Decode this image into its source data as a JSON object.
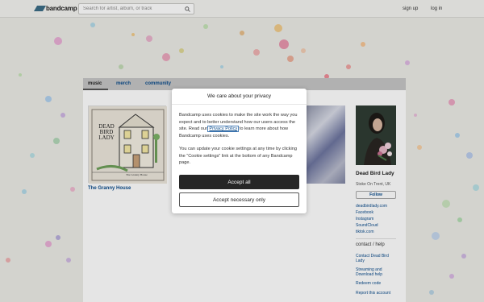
{
  "header": {
    "logo_text": "bandcamp",
    "search_placeholder": "Search for artist, album, or track",
    "sign_up": "sign up",
    "log_in": "log in"
  },
  "tabs": [
    {
      "label": "music"
    },
    {
      "label": "merch"
    },
    {
      "label": "community"
    }
  ],
  "album": {
    "title": "The Granny House",
    "art_text": [
      "DEAD",
      "BIRD",
      "LADY",
      "The Granny House"
    ]
  },
  "artist": {
    "name": "Dead Bird Lady",
    "location": "Stoke On Trent, UK",
    "follow_label": "Follow",
    "links": [
      "deadbirdlady.com",
      "Facebook",
      "Instagram",
      "SoundCloud",
      "tiktok.com"
    ],
    "contact_heading": "contact / help",
    "contact_links": [
      "Contact Dead Bird Lady",
      "Streaming and Download help",
      "Redeem code",
      "Report this account"
    ]
  },
  "cookie_dialog": {
    "title": "We care about your privacy",
    "para1_before": "Bandcamp uses cookies to make the site work the way you expect and to better understand how our users access the site. Read our ",
    "privacy_link": "Privacy Policy",
    "para1_after": " to learn more about how Bandcamp uses cookies.",
    "para2": "You can update your cookie settings at any time by clicking the “Cookie settings” link at the bottom of any Bandcamp page.",
    "accept_all": "Accept all",
    "accept_necessary": "Accept necessary only"
  },
  "colors": {
    "link": "#0b4c8c",
    "brand": "#3b6d86",
    "primary_button": "#262626"
  }
}
